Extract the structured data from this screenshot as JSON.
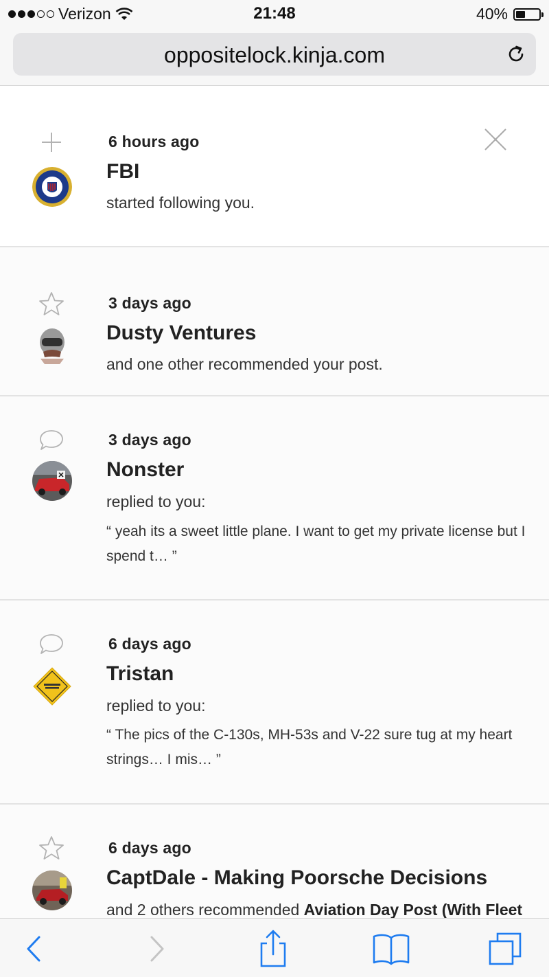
{
  "status_bar": {
    "carrier": "Verizon",
    "time": "21:48",
    "battery_text": "40%",
    "battery_level": 0.4,
    "signal_bars": 3
  },
  "browser": {
    "url": "oppositelock.kinja.com"
  },
  "notifications": [
    {
      "type_icon": "plus-icon",
      "time": "6 hours ago",
      "name": "FBI",
      "action": "started following you.",
      "quote": ""
    },
    {
      "type_icon": "star-icon",
      "time": "3 days ago",
      "name": "Dusty Ventures",
      "action": "and one other recommended your post.",
      "quote": ""
    },
    {
      "type_icon": "comment-icon",
      "time": "3 days ago",
      "name": "Nonster",
      "action": "replied to you:",
      "quote": "“ yeah its a sweet little plane. I want to get my private license but I spend t… ”"
    },
    {
      "type_icon": "comment-icon",
      "time": "6 days ago",
      "name": "Tristan",
      "action": "replied to you:",
      "quote": "“ The pics of the C-130s, MH-53s and V-22 sure tug at my heart strings… I mis… ”"
    },
    {
      "type_icon": "star-icon",
      "time": "6 days ago",
      "name": "CaptDale - Making Poorsche Decisions",
      "action_prefix": "and 2 others recommended ",
      "action_bold": "Aviation Day Post (With Fleet"
    }
  ],
  "colors": {
    "ios_blue": "#1e7cf0",
    "icon_gray": "#b3b3b3"
  }
}
